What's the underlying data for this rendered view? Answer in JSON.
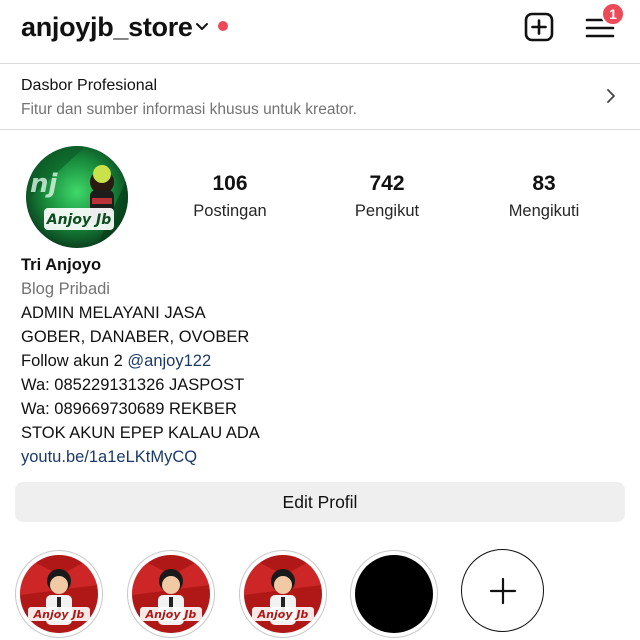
{
  "header": {
    "username": "anjoyjb_store",
    "notification_count": "1",
    "accent_red": "#ed4956"
  },
  "dashboard": {
    "title": "Dasbor Profesional",
    "subtitle": "Fitur dan sumber informasi khusus untuk kreator."
  },
  "avatar": {
    "text": "Anjoy Jb"
  },
  "stats": [
    {
      "value": "106",
      "label": "Postingan"
    },
    {
      "value": "742",
      "label": "Pengikut"
    },
    {
      "value": "83",
      "label": "Mengikuti"
    }
  ],
  "bio": {
    "name": "Tri Anjoyo",
    "category": "Blog Pribadi",
    "line1": "ADMIN MELAYANI JASA",
    "line2": "GOBER, DANABER, OVOBER",
    "line3_prefix": "Follow akun 2 ",
    "line3_mention": "@anjoy122",
    "line4": "Wa: 085229131326 JASPOST",
    "line5": "Wa: 089669730689 REKBER",
    "line6": "STOK AKUN EPEP KALAU ADA",
    "link": "youtu.be/1a1eLKtMyCQ"
  },
  "actions": {
    "edit_profile": "Edit Profil"
  },
  "highlights": [
    {
      "label": "",
      "cover": "anjoyjb-logo"
    },
    {
      "label": "",
      "cover": "anjoyjb-logo"
    },
    {
      "label": "",
      "cover": "anjoyjb-logo"
    },
    {
      "label": "",
      "cover": "black"
    },
    {
      "label": "",
      "cover": "new"
    }
  ]
}
